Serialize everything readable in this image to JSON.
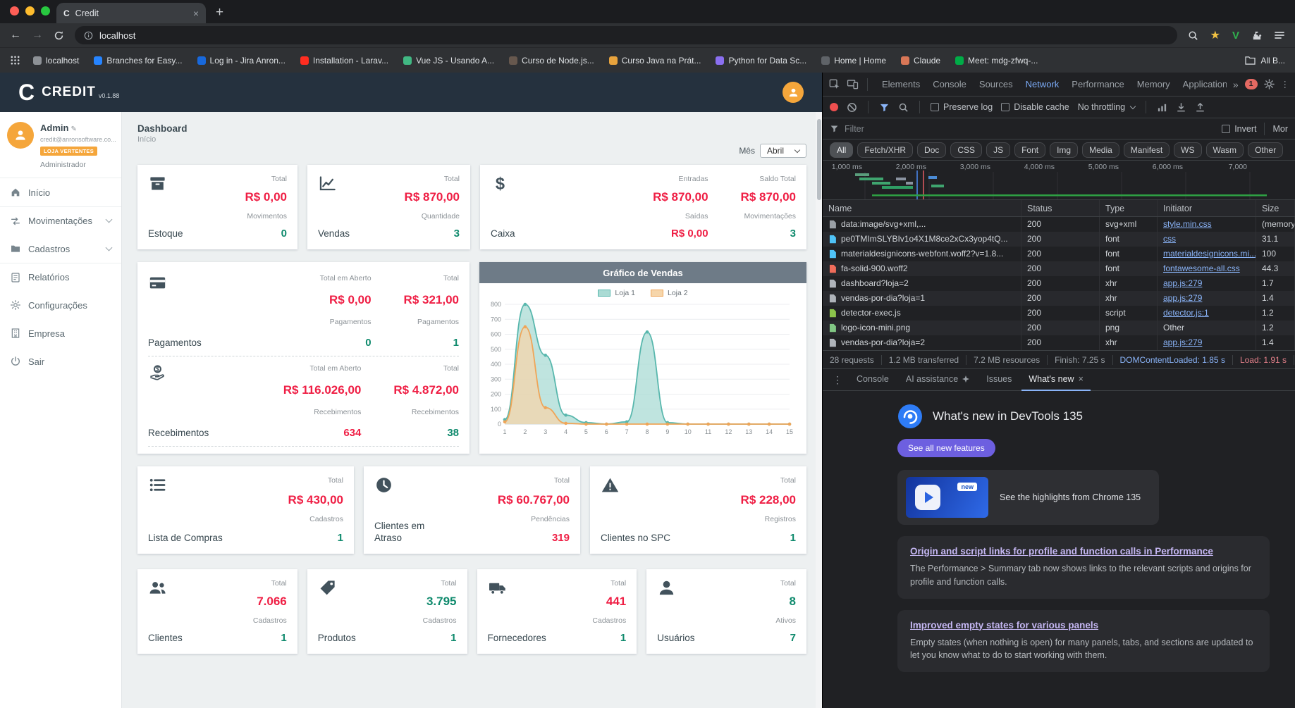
{
  "browser": {
    "tab": {
      "title": "Credit",
      "favicon_letter": "C"
    },
    "address": "localhost",
    "bookmarks": [
      {
        "label": "localhost",
        "color": "#8d9196"
      },
      {
        "label": "Branches for Easy...",
        "color": "#2684ff"
      },
      {
        "label": "Log in - Jira Anron...",
        "color": "#1868db"
      },
      {
        "label": "Installation - Larav...",
        "color": "#ff2d20"
      },
      {
        "label": "Vue JS - Usando A...",
        "color": "#41b883"
      },
      {
        "label": "Curso de Node.js...",
        "color": "#67584e"
      },
      {
        "label": "Curso Java na Prát...",
        "color": "#e8a33d"
      },
      {
        "label": "Python for Data Sc...",
        "color": "#8a6ff0"
      },
      {
        "label": "Home | Home",
        "color": "#5f6368"
      },
      {
        "label": "Claude",
        "color": "#d97757"
      },
      {
        "label": "Meet: mdg-zfwq-...",
        "color": "#00ac47"
      }
    ],
    "all_bookmarks": "All B..."
  },
  "app": {
    "brand": {
      "initial": "C",
      "name": "CREDIT",
      "version": "v0.1.88"
    },
    "user": {
      "name": "Admin",
      "email": "credit@anronsoftware.co...",
      "badge": "LOJA VERTENTES",
      "role": "Administrador"
    },
    "menu": [
      {
        "label": "Início",
        "icon": "home"
      },
      {
        "label": "Movimentações",
        "icon": "swap",
        "chevron": true,
        "divider": true
      },
      {
        "label": "Cadastros",
        "icon": "folder",
        "chevron": true
      },
      {
        "label": "Relatórios",
        "icon": "report",
        "divider": true
      },
      {
        "label": "Configurações",
        "icon": "gear"
      },
      {
        "label": "Empresa",
        "icon": "building"
      },
      {
        "label": "Sair",
        "icon": "power"
      }
    ],
    "page": {
      "title": "Dashboard",
      "subtitle": "Início"
    },
    "month_filter": {
      "label": "Mês",
      "value": "Abril"
    },
    "cards": {
      "estoque": {
        "title": "Estoque",
        "rows": [
          {
            "label": "Total",
            "value": "R$ 0,00",
            "tone": "red"
          },
          {
            "label": "Movimentos",
            "value": "0",
            "tone": "green"
          }
        ]
      },
      "vendas": {
        "title": "Vendas",
        "rows": [
          {
            "label": "Total",
            "value": "R$ 870,00",
            "tone": "red"
          },
          {
            "label": "Quantidade",
            "value": "3",
            "tone": "green"
          }
        ]
      },
      "caixa": {
        "title": "Caixa",
        "groups": [
          [
            {
              "label": "Entradas",
              "value": "R$ 870,00",
              "tone": "red"
            },
            {
              "label": "Saídas",
              "value": "R$ 0,00",
              "tone": "red"
            }
          ],
          [
            {
              "label": "Saldo Total",
              "value": "R$ 870,00",
              "tone": "red"
            },
            {
              "label": "Movimentações",
              "value": "3",
              "tone": "green"
            }
          ]
        ]
      },
      "pagamentos": {
        "title": "Pagamentos",
        "groups": [
          [
            {
              "label": "Total em Aberto",
              "value": "R$ 0,00",
              "tone": "red"
            },
            {
              "label": "Pagamentos",
              "value": "0",
              "tone": "green"
            }
          ],
          [
            {
              "label": "Total",
              "value": "R$ 321,00",
              "tone": "red"
            },
            {
              "label": "Pagamentos",
              "value": "1",
              "tone": "green"
            }
          ]
        ]
      },
      "recebimentos": {
        "title": "Recebimentos",
        "groups": [
          [
            {
              "label": "Total em Aberto",
              "value": "R$ 116.026,00",
              "tone": "red"
            },
            {
              "label": "Recebimentos",
              "value": "634",
              "tone": "red"
            }
          ],
          [
            {
              "label": "Total",
              "value": "R$ 4.872,00",
              "tone": "red"
            },
            {
              "label": "Recebimentos",
              "value": "38",
              "tone": "green"
            }
          ]
        ]
      },
      "lista_compras": {
        "title": "Lista de Compras",
        "rows": [
          {
            "label": "Total",
            "value": "R$ 430,00",
            "tone": "red"
          },
          {
            "label": "Cadastros",
            "value": "1",
            "tone": "green"
          }
        ]
      },
      "clientes_atraso": {
        "title": "Clientes em Atraso",
        "rows": [
          {
            "label": "Total",
            "value": "R$ 60.767,00",
            "tone": "red"
          },
          {
            "label": "Pendências",
            "value": "319",
            "tone": "red"
          }
        ]
      },
      "clientes_spc": {
        "title": "Clientes no SPC",
        "rows": [
          {
            "label": "Total",
            "value": "R$ 228,00",
            "tone": "red"
          },
          {
            "label": "Registros",
            "value": "1",
            "tone": "green"
          }
        ]
      },
      "clientes": {
        "title": "Clientes",
        "rows": [
          {
            "label": "Total",
            "value": "7.066",
            "tone": "red"
          },
          {
            "label": "Cadastros",
            "value": "1",
            "tone": "green"
          }
        ]
      },
      "produtos": {
        "title": "Produtos",
        "rows": [
          {
            "label": "Total",
            "value": "3.795",
            "tone": "green"
          },
          {
            "label": "Cadastros",
            "value": "1",
            "tone": "green"
          }
        ]
      },
      "fornecedores": {
        "title": "Fornecedores",
        "rows": [
          {
            "label": "Total",
            "value": "441",
            "tone": "red"
          },
          {
            "label": "Cadastros",
            "value": "1",
            "tone": "green"
          }
        ]
      },
      "usuarios": {
        "title": "Usuários",
        "rows": [
          {
            "label": "Total",
            "value": "8",
            "tone": "green"
          },
          {
            "label": "Ativos",
            "value": "7",
            "tone": "green"
          }
        ]
      }
    }
  },
  "chart_data": {
    "type": "area",
    "title": "Gráfico de Vendas",
    "x": [
      1,
      2,
      3,
      4,
      5,
      6,
      7,
      8,
      9,
      10,
      11,
      12,
      13,
      14,
      15
    ],
    "ylim": [
      0,
      800
    ],
    "ytick_step": 100,
    "legend_position": "top",
    "grid": true,
    "series": [
      {
        "name": "Loja 1",
        "color": "#58b7ad",
        "fill": "#aadbd4",
        "values": [
          30,
          800,
          460,
          60,
          10,
          0,
          15,
          615,
          10,
          0,
          0,
          0,
          0,
          0,
          0
        ]
      },
      {
        "name": "Loja 2",
        "color": "#efa558",
        "fill": "#f6d6ab",
        "values": [
          15,
          650,
          110,
          5,
          0,
          0,
          0,
          0,
          0,
          0,
          0,
          0,
          0,
          0,
          0
        ]
      }
    ]
  },
  "devtools": {
    "tabs": [
      "Elements",
      "Console",
      "Sources",
      "Network",
      "Performance",
      "Memory",
      "Application"
    ],
    "active_tab": "Network",
    "error_badge": "1",
    "network_toolbar": {
      "preserve_log": "Preserve log",
      "disable_cache": "Disable cache",
      "throttling": "No throttling"
    },
    "filter": {
      "placeholder": "Filter",
      "invert": "Invert",
      "more": "Mor"
    },
    "chips": [
      "All",
      "Fetch/XHR",
      "Doc",
      "CSS",
      "JS",
      "Font",
      "Img",
      "Media",
      "Manifest",
      "WS",
      "Wasm",
      "Other"
    ],
    "active_chip": "All",
    "timeline_labels": [
      "1,000 ms",
      "2,000 ms",
      "3,000 ms",
      "4,000 ms",
      "5,000 ms",
      "6,000 ms",
      "7,000"
    ],
    "table": {
      "columns": [
        "Name",
        "Status",
        "Type",
        "Initiator",
        "Size"
      ],
      "rows": [
        {
          "name": "data:image/svg+xml,...",
          "status": "200",
          "type": "svg+xml",
          "initiator": "style.min.css",
          "link": true,
          "size": "(memory",
          "icon": "doc"
        },
        {
          "name": "pe0TMImSLYBIv1o4X1M8ce2xCx3yop4tQ...",
          "status": "200",
          "type": "font",
          "initiator": "css",
          "link": true,
          "size": "31.1",
          "icon": "font"
        },
        {
          "name": "materialdesignicons-webfont.woff2?v=1.8...",
          "status": "200",
          "type": "font",
          "initiator": "materialdesignicons.mi...",
          "link": true,
          "size": "100",
          "icon": "font"
        },
        {
          "name": "fa-solid-900.woff2",
          "status": "200",
          "type": "font",
          "initiator": "fontawesome-all.css",
          "link": true,
          "size": "44.3",
          "icon": "fontred"
        },
        {
          "name": "dashboard?loja=2",
          "status": "200",
          "type": "xhr",
          "initiator": "app.js:279",
          "link": true,
          "size": "1.7",
          "icon": "xhr"
        },
        {
          "name": "vendas-por-dia?loja=1",
          "status": "200",
          "type": "xhr",
          "initiator": "app.js:279",
          "link": true,
          "size": "1.4",
          "icon": "xhr"
        },
        {
          "name": "detector-exec.js",
          "status": "200",
          "type": "script",
          "initiator": "detector.js:1",
          "link": true,
          "size": "1.2",
          "icon": "script"
        },
        {
          "name": "logo-icon-mini.png",
          "status": "200",
          "type": "png",
          "initiator": "Other",
          "link": false,
          "size": "1.2",
          "icon": "img"
        },
        {
          "name": "vendas-por-dia?loja=2",
          "status": "200",
          "type": "xhr",
          "initiator": "app.js:279",
          "link": true,
          "size": "1.4",
          "icon": "xhr"
        }
      ]
    },
    "summary": {
      "requests": "28 requests",
      "transferred": "1.2 MB transferred",
      "resources": "7.2 MB resources",
      "finish": "Finish: 7.25 s",
      "dcl": "DOMContentLoaded: 1.85 s",
      "load": "Load: 1.91 s"
    },
    "drawer_tabs": [
      "Console",
      "AI assistance",
      "Issues",
      "What's new"
    ],
    "whats_new": {
      "title": "What's new in DevTools 135",
      "button": "See all new features",
      "badge": "new",
      "highlight": "See the highlights from Chrome 135",
      "sections": [
        {
          "title": "Origin and script links for profile and function calls in Performance",
          "body": "The Performance > Summary tab now shows links to the relevant scripts and origins for profile and function calls."
        },
        {
          "title": "Improved empty states for various panels",
          "body": "Empty states (when nothing is open) for many panels, tabs, and sections are updated to let you know what to do to start working with them."
        }
      ]
    }
  }
}
